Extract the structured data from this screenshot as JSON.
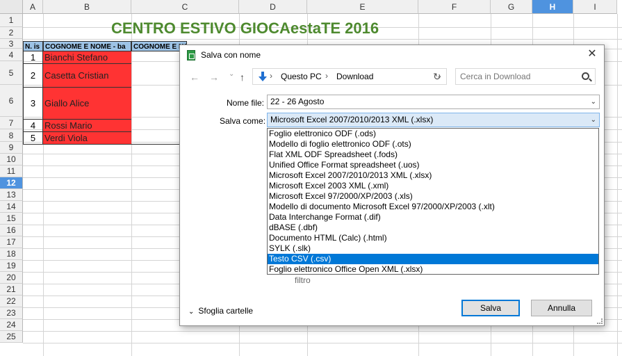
{
  "sheet": {
    "columns": [
      "A",
      "B",
      "C",
      "D",
      "E",
      "F",
      "G",
      "H",
      "I"
    ],
    "selected_column": "H",
    "rows": [
      "1",
      "2",
      "3",
      "4",
      "5",
      "6",
      "7",
      "8",
      "9",
      "10",
      "11",
      "12",
      "13",
      "14",
      "15",
      "16",
      "17",
      "18",
      "19",
      "20",
      "21",
      "22",
      "23",
      "24",
      "25"
    ],
    "selected_row": "12",
    "title": "CENTRO ESTIVO GIOCAestaTE  2016",
    "header_cells": [
      "N. is",
      "COGNOME E NOME - ba",
      "COGNOME E NOME - Sc"
    ],
    "records": [
      {
        "num": "1",
        "name": "Bianchi Stefano"
      },
      {
        "num": "2",
        "name": "Casetta Cristian"
      },
      {
        "num": "3",
        "name": "Giallo Alice"
      },
      {
        "num": "4",
        "name": "Rossi Mario"
      },
      {
        "num": "5",
        "name": "Verdi Viola"
      }
    ]
  },
  "dialog": {
    "title": "Salva con nome",
    "close_icon": "close-icon",
    "breadcrumb": [
      "Questo PC",
      "Download"
    ],
    "search_placeholder": "Cerca in Download",
    "filename_label": "Nome file:",
    "filename_value": "22 - 26 Agosto",
    "saveas_label": "Salva come:",
    "saveas_value": "Microsoft Excel 2007/2010/2013 XML (.xlsx)",
    "filter_text": "filtro",
    "browse_label": "Sfoglia cartelle",
    "save_button": "Salva",
    "cancel_button": "Annulla",
    "file_types": [
      "Foglio elettronico ODF (.ods)",
      "Modello di foglio elettronico ODF (.ots)",
      "Flat XML ODF Spreadsheet (.fods)",
      "Unified Office Format spreadsheet (.uos)",
      "Microsoft Excel 2007/2010/2013 XML (.xlsx)",
      "Microsoft Excel 2003 XML (.xml)",
      "Microsoft Excel 97/2000/XP/2003 (.xls)",
      "Modello di documento Microsoft Excel 97/2000/XP/2003 (.xlt)",
      "Data Interchange Format (.dif)",
      "dBASE (.dbf)",
      "Documento HTML (Calc) (.html)",
      "SYLK (.slk)",
      "Testo CSV (.csv)",
      "Foglio elettronico Office Open XML (.xlsx)"
    ],
    "selected_file_type": "Testo CSV (.csv)",
    "colors": {
      "accent": "#0078d7",
      "title_green": "#4e8a2f",
      "name_red": "#ff3333",
      "header_blue": "#9dc3e6"
    }
  }
}
